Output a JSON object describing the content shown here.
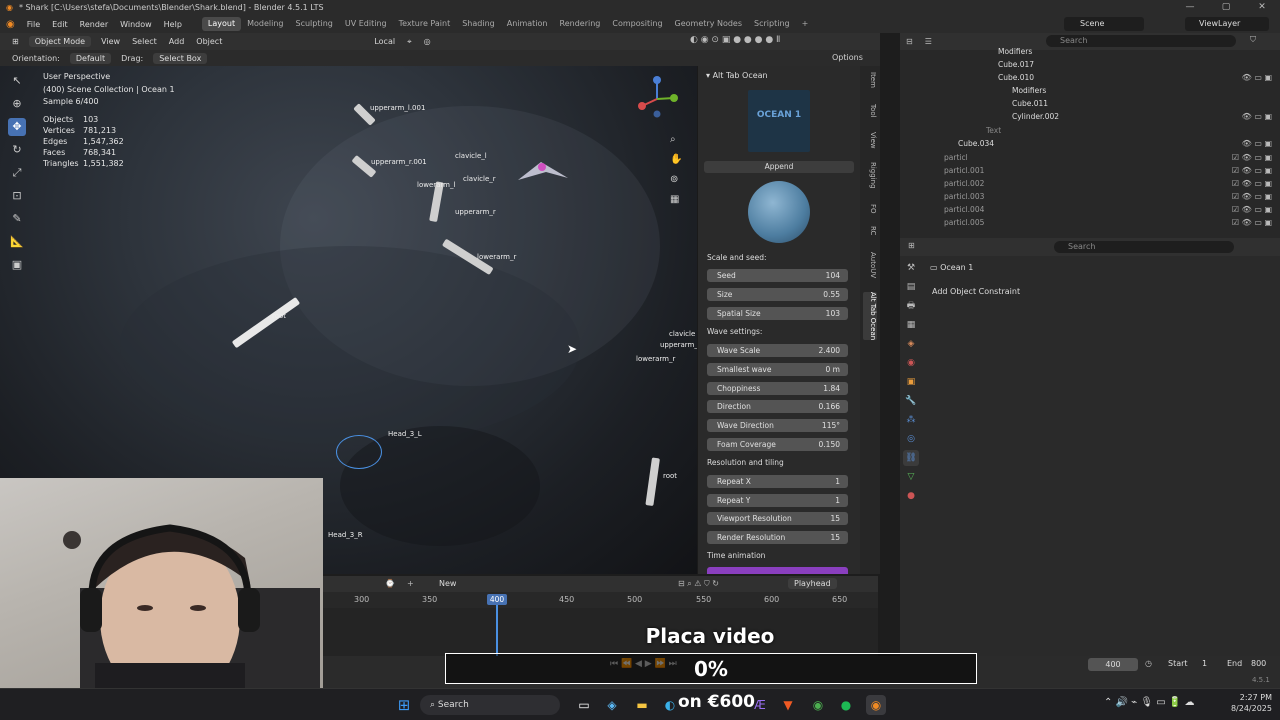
{
  "titlebar": {
    "title": "* Shark [C:\\Users\\stefa\\Documents\\Blender\\Shark.blend] - Blender 4.5.1 LTS"
  },
  "menu": {
    "items": [
      "File",
      "Edit",
      "Render",
      "Window",
      "Help"
    ],
    "workspaces": [
      "Layout",
      "Modeling",
      "Sculpting",
      "UV Editing",
      "Texture Paint",
      "Shading",
      "Animation",
      "Rendering",
      "Compositing",
      "Geometry Nodes",
      "Scripting"
    ],
    "active_workspace": "Layout",
    "scene": "Scene",
    "view_layer": "ViewLayer"
  },
  "viewport_header": {
    "mode": "Object Mode",
    "items": [
      "View",
      "Select",
      "Add",
      "Object"
    ],
    "transform": "Local",
    "orientation_label": "Orientation:",
    "orientation": "Default",
    "drag_label": "Drag:",
    "drag": "Select Box",
    "options": "Options"
  },
  "overlay_info": {
    "perspective": "User Perspective",
    "collection": "(400) Scene Collection | Ocean 1",
    "sample": "Sample 6/400",
    "stats": [
      {
        "label": "Objects",
        "value": "103"
      },
      {
        "label": "Vertices",
        "value": "781,213"
      },
      {
        "label": "Edges",
        "value": "1,547,362"
      },
      {
        "label": "Faces",
        "value": "768,341"
      },
      {
        "label": "Triangles",
        "value": "1,551,382"
      }
    ]
  },
  "bones": [
    "upperarm_l.001",
    "upperarm_r.001",
    "clavicle_l",
    "clavicle_r",
    "lowerarm_l",
    "upperarm_r",
    "lowerarm_r",
    "root",
    "root",
    "clavicle",
    "upperarm_r",
    "lowerarm_r",
    "Head_3_L",
    "Head_3_R"
  ],
  "npanel": {
    "title": "Alt Tab Ocean",
    "preview_text": "OCEAN 1",
    "append": "Append",
    "sections": {
      "scale_seed": "Scale and seed:",
      "wave_settings": "Wave settings:",
      "resolution": "Resolution and tiling",
      "time": "Time animation"
    },
    "scale_seed": [
      {
        "label": "Seed",
        "value": "104"
      },
      {
        "label": "Size",
        "value": "0.55"
      },
      {
        "label": "Spatial Size",
        "value": "103"
      }
    ],
    "wave": [
      {
        "label": "Wave Scale",
        "value": "2.400"
      },
      {
        "label": "Smallest wave",
        "value": "0 m"
      },
      {
        "label": "Choppiness",
        "value": "1.84"
      },
      {
        "label": "Direction",
        "value": "0.166"
      },
      {
        "label": "Wave Direction",
        "value": "115°"
      },
      {
        "label": "Foam Coverage",
        "value": "0.150"
      }
    ],
    "resolution": [
      {
        "label": "Repeat X",
        "value": "1"
      },
      {
        "label": "Repeat Y",
        "value": "1"
      },
      {
        "label": "Viewport Resolution",
        "value": "15"
      },
      {
        "label": "Render Resolution",
        "value": "15"
      }
    ],
    "tabs": [
      "Item",
      "Tool",
      "View",
      "Rigging",
      "FO",
      "RC",
      "AutoUV",
      "Alt Tab Ocean"
    ]
  },
  "outliner": {
    "search_placeholder": "Search",
    "rows": [
      {
        "name": "Modifiers"
      },
      {
        "name": "Cube.017"
      },
      {
        "name": "Cube.010"
      },
      {
        "name": "Modifiers"
      },
      {
        "name": "Cube.011"
      },
      {
        "name": "Cylinder.002"
      },
      {
        "name": "Text"
      },
      {
        "name": "Cube.034"
      },
      {
        "name": "particl"
      },
      {
        "name": "particl.001"
      },
      {
        "name": "particl.002"
      },
      {
        "name": "particl.003"
      },
      {
        "name": "particl.004"
      },
      {
        "name": "particl.005"
      }
    ]
  },
  "properties": {
    "search_placeholder": "Search",
    "object": "Ocean 1",
    "add_constraint": "Add Object Constraint"
  },
  "timeline": {
    "new": "New",
    "playhead": "Playhead",
    "ticks": [
      "300",
      "350",
      "400",
      "450",
      "500",
      "550",
      "600",
      "650"
    ],
    "current_frame": "400",
    "frame_field": "400",
    "start_label": "Start",
    "start": "1",
    "end_label": "End",
    "end": "800",
    "version": "4.5.1"
  },
  "video_overlay": {
    "title": "Placa video",
    "percent": "0%",
    "progress": 0.0
  },
  "taskbar": {
    "search": "Search",
    "price": "on €600",
    "time": "2:27 PM",
    "date": "8/24/2025"
  }
}
